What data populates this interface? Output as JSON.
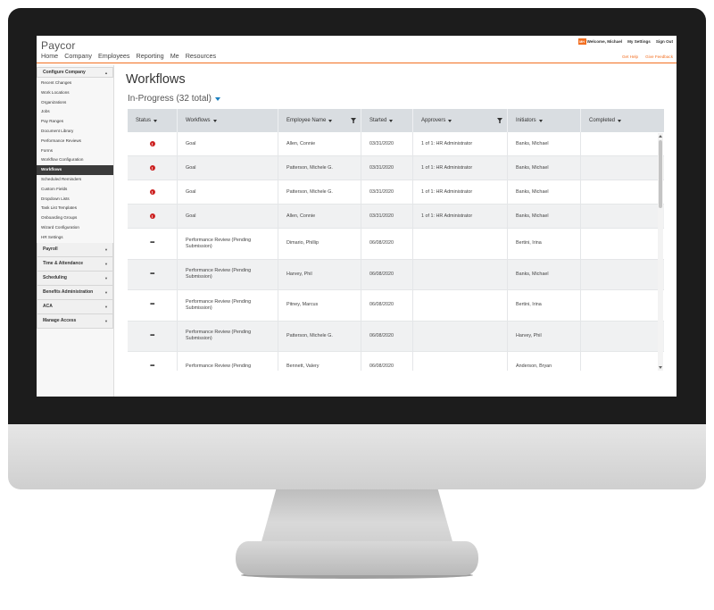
{
  "app": {
    "logo_text": "Paycor",
    "nav": [
      "Home",
      "Company",
      "Employees",
      "Reporting",
      "Me",
      "Resources"
    ],
    "user_initials": "MH",
    "welcome": "Welcome, Michael",
    "my_settings": "My Settings",
    "sign_out": "Sign Out",
    "get_help": "Get Help",
    "give_feedback": "Give Feedback",
    "accent_color": "#f26f21"
  },
  "sidebar": {
    "open_section": "Configure Company",
    "items": [
      "Recent Changes",
      "Work Locations",
      "Organizations",
      "Jobs",
      "Pay Ranges",
      "Document Library",
      "Performance Reviews",
      "Forms",
      "Workflow Configuration",
      "Workflows",
      "Scheduled Reminders",
      "Custom Fields",
      "Dropdown Lists",
      "Task List Templates",
      "Onboarding Groups",
      "Wizard Configuration",
      "HR Settings"
    ],
    "active_item": "Workflows",
    "collapsed_sections": [
      "Payroll",
      "Time & Attendance",
      "Scheduling",
      "Benefits Administration",
      "ACA",
      "Manage Access"
    ]
  },
  "main": {
    "title": "Workflows",
    "subtitle": "In-Progress (32 total)"
  },
  "table": {
    "columns": [
      "Status",
      "Workflows",
      "Employee Name",
      "Started",
      "Approvers",
      "Initiators",
      "Completed"
    ],
    "rows": [
      {
        "status": "alert",
        "workflow": "Goal",
        "employee": "Allen, Connie",
        "started": "03/31/2020",
        "approvers": "1 of 1: HR Administrator",
        "initiator": "Banks, Michael",
        "completed": ""
      },
      {
        "status": "alert",
        "workflow": "Goal",
        "employee": "Patterson, Michele G.",
        "started": "03/31/2020",
        "approvers": "1 of 1: HR Administrator",
        "initiator": "Banks, Michael",
        "completed": ""
      },
      {
        "status": "alert",
        "workflow": "Goal",
        "employee": "Patterson, Michele G.",
        "started": "03/31/2020",
        "approvers": "1 of 1: HR Administrator",
        "initiator": "Banks, Michael",
        "completed": ""
      },
      {
        "status": "alert",
        "workflow": "Goal",
        "employee": "Allen, Connie",
        "started": "03/31/2020",
        "approvers": "1 of 1: HR Administrator",
        "initiator": "Banks, Michael",
        "completed": ""
      },
      {
        "status": "pending",
        "workflow": "Performance Review (Pending Submission)",
        "employee": "Dimario, Phillip",
        "started": "06/08/2020",
        "approvers": "",
        "initiator": "Bertini, Irina",
        "completed": ""
      },
      {
        "status": "pending",
        "workflow": "Performance Review (Pending Submission)",
        "employee": "Harvey, Phil",
        "started": "06/08/2020",
        "approvers": "",
        "initiator": "Banks, Michael",
        "completed": ""
      },
      {
        "status": "pending",
        "workflow": "Performance Review (Pending Submission)",
        "employee": "Pitney, Marcus",
        "started": "06/08/2020",
        "approvers": "",
        "initiator": "Bertini, Irina",
        "completed": ""
      },
      {
        "status": "pending",
        "workflow": "Performance Review (Pending Submission)",
        "employee": "Patterson, Michele G.",
        "started": "06/08/2020",
        "approvers": "",
        "initiator": "Harvey, Phil",
        "completed": ""
      },
      {
        "status": "pending",
        "workflow": "Performance Review (Pending",
        "employee": "Bennett, Valery",
        "started": "06/08/2020",
        "approvers": "",
        "initiator": "Anderson, Bryan",
        "completed": ""
      }
    ]
  }
}
